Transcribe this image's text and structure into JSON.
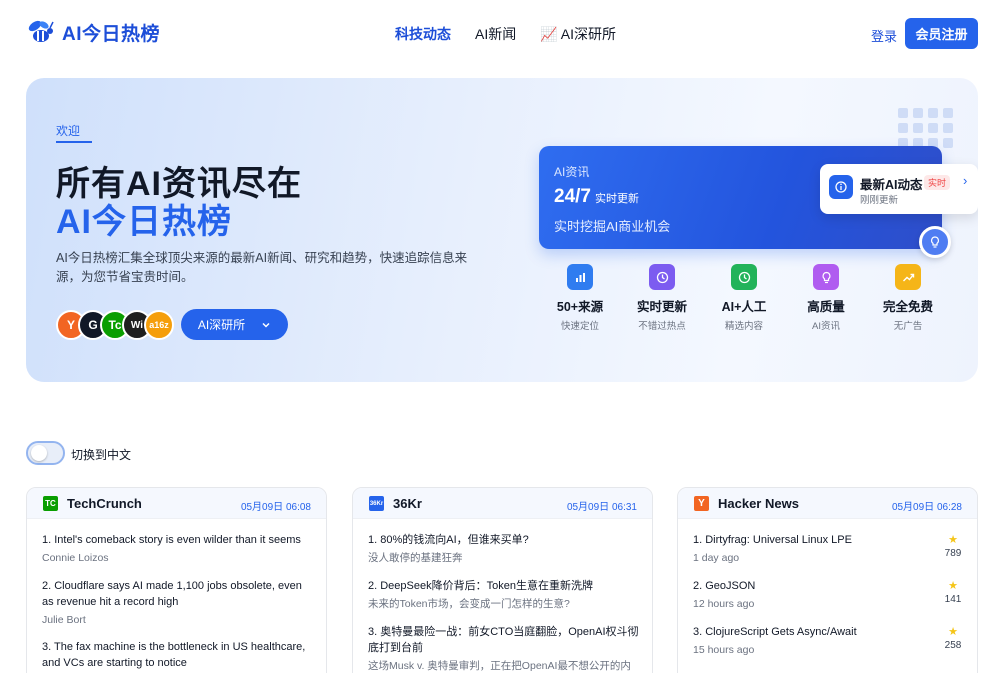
{
  "header": {
    "logo_text": "AI今日热榜",
    "nav": [
      {
        "label": "科技动态",
        "active": true
      },
      {
        "label": "AI新闻",
        "active": false
      },
      {
        "label": "📈 AI深研所",
        "active": false
      }
    ],
    "login": "登录",
    "register": "会员注册"
  },
  "hero": {
    "welcome": "欢迎",
    "headline_1": "所有AI资讯尽在",
    "headline_2": "AI今日热榜",
    "description": "AI今日热榜汇集全球顶尖来源的最新AI新闻、研究和趋势，快速追踪信息来源，为您节省宝贵时间。",
    "avatars": [
      {
        "letter": "Y",
        "color": "#f26522"
      },
      {
        "letter": "G",
        "color": "#111827"
      },
      {
        "letter": "Tc",
        "color": "#0a9e01"
      },
      {
        "letter": "Wi",
        "color": "#1f1f1f"
      },
      {
        "letter": "a16z",
        "color": "#f59e0b"
      }
    ],
    "deep_button": "AI深研所",
    "card": {
      "label": "AI资讯",
      "number": "24/7",
      "number_sub": "实时更新",
      "desc": "实时挖掘AI商业机会"
    },
    "float_card": {
      "title": "最新AI动态",
      "badge": "实时",
      "sub": "刚刚更新"
    },
    "features": [
      {
        "title": "50+来源",
        "sub": "快速定位",
        "icon": "chart-icon",
        "color": "#2f7cf0"
      },
      {
        "title": "实时更新",
        "sub": "不错过热点",
        "icon": "clock-icon",
        "color": "#7c5cf0"
      },
      {
        "title": "AI+人工",
        "sub": "精选内容",
        "icon": "clock-check-icon",
        "color": "#22b35a"
      },
      {
        "title": "高质量",
        "sub": "AI资讯",
        "icon": "bulb-icon",
        "color": "#b05cf0"
      },
      {
        "title": "完全免费",
        "sub": "无广告",
        "icon": "trend-icon",
        "color": "#f5b518"
      }
    ]
  },
  "toggle_label": "切换到中文",
  "cards": [
    {
      "name": "TechCrunch",
      "logo": "TC",
      "logo_color": "#0a9e01",
      "time": "05月09日 06:08",
      "items": [
        {
          "title": "1. Intel's comeback story is even wilder than it seems",
          "sub": "Connie Loizos"
        },
        {
          "title": "2. Cloudflare says AI made 1,100 jobs obsolete, even as revenue hit a record high",
          "sub": "Julie Bort"
        },
        {
          "title": "3. The fax machine is the bottleneck in US healthcare, and VCs are starting to notice",
          "sub": ""
        }
      ]
    },
    {
      "name": "36Kr",
      "logo": "36Kr",
      "logo_color": "#2563eb",
      "time": "05月09日 06:31",
      "items": [
        {
          "title": "1. 80%的钱流向AI，但谁来买单?",
          "sub": "没人敢停的基建狂奔"
        },
        {
          "title": "2. DeepSeek降价背后：Token生意在重新洗牌",
          "sub": "未来的Token市场，会变成一门怎样的生意?"
        },
        {
          "title": "3. 奥特曼最险一战：前女CTO当庭翻脸，OpenAI权斗彻底打到台前",
          "sub": "这场Musk v. 奥特曼审判，正在把OpenAI最不想公开的内"
        }
      ]
    },
    {
      "name": "Hacker News",
      "logo": "Y",
      "logo_color": "#f26522",
      "time": "05月09日 06:28",
      "items": [
        {
          "title": "1. Dirtyfrag: Universal Linux LPE",
          "sub": "1 day ago",
          "stars": "789"
        },
        {
          "title": "2. GeoJSON",
          "sub": "12 hours ago",
          "stars": "141"
        },
        {
          "title": "3. ClojureScript Gets Async/Await",
          "sub": "15 hours ago",
          "stars": "258"
        }
      ]
    }
  ]
}
